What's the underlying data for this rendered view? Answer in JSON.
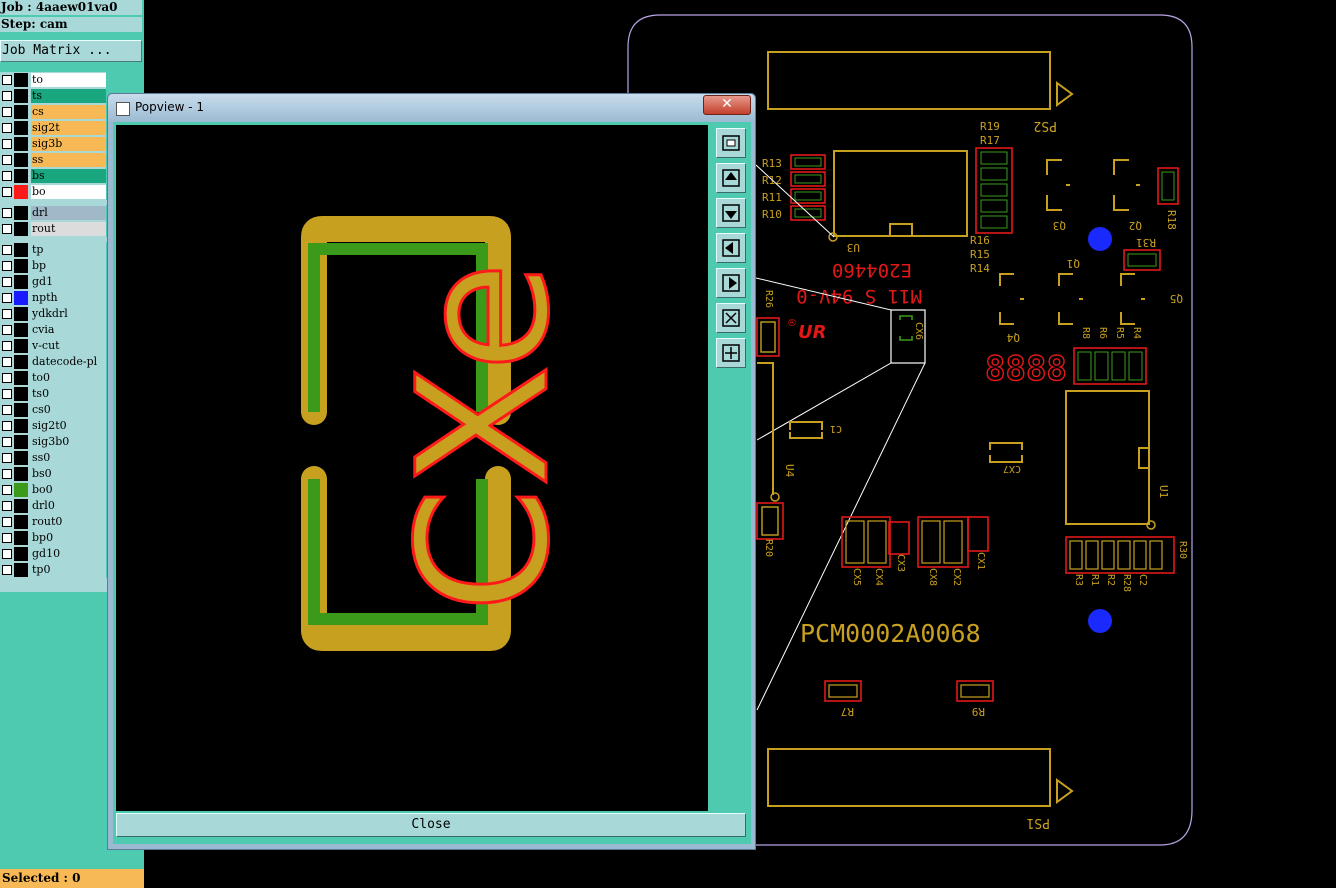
{
  "left_panel": {
    "job_line": "Job : 4aaew01va0",
    "step_line": "Step: cam",
    "job_matrix_label": "Job Matrix ...",
    "layers": [
      {
        "name": "to",
        "name_bg": "#ffffff",
        "swatch": ""
      },
      {
        "name": "ts",
        "name_bg": "#1aa67e",
        "swatch": ""
      },
      {
        "name": "cs",
        "name_bg": "#f7b955",
        "swatch": ""
      },
      {
        "name": "sig2t",
        "name_bg": "#f7b955",
        "swatch": ""
      },
      {
        "name": "sig3b",
        "name_bg": "#f7b955",
        "swatch": ""
      },
      {
        "name": "ss",
        "name_bg": "#f7b955",
        "swatch": ""
      },
      {
        "name": "bs",
        "name_bg": "#1aa67e",
        "swatch": ""
      },
      {
        "name": "bo",
        "name_bg": "#ffffff",
        "swatch": "#ff1a1a"
      },
      {
        "name": "drl",
        "name_bg": "#a0b8c8",
        "swatch": ""
      },
      {
        "name": "rout",
        "name_bg": "#dcdcdc",
        "swatch": ""
      },
      {
        "name": "tp",
        "name_bg": "#a8d8d8",
        "swatch": ""
      },
      {
        "name": "bp",
        "name_bg": "#a8d8d8",
        "swatch": ""
      },
      {
        "name": "gd1",
        "name_bg": "#a8d8d8",
        "swatch": ""
      },
      {
        "name": "npth",
        "name_bg": "#a8d8d8",
        "swatch": "#1a1aff"
      },
      {
        "name": "ydkdrl",
        "name_bg": "#a8d8d8",
        "swatch": ""
      },
      {
        "name": "cvia",
        "name_bg": "#a8d8d8",
        "swatch": ""
      },
      {
        "name": "v-cut",
        "name_bg": "#a8d8d8",
        "swatch": ""
      },
      {
        "name": "datecode-pl",
        "name_bg": "#a8d8d8",
        "swatch": ""
      },
      {
        "name": "to0",
        "name_bg": "#a8d8d8",
        "swatch": ""
      },
      {
        "name": "ts0",
        "name_bg": "#a8d8d8",
        "swatch": ""
      },
      {
        "name": "cs0",
        "name_bg": "#a8d8d8",
        "swatch": ""
      },
      {
        "name": "sig2t0",
        "name_bg": "#a8d8d8",
        "swatch": ""
      },
      {
        "name": "sig3b0",
        "name_bg": "#a8d8d8",
        "swatch": ""
      },
      {
        "name": "ss0",
        "name_bg": "#a8d8d8",
        "swatch": ""
      },
      {
        "name": "bs0",
        "name_bg": "#a8d8d8",
        "swatch": ""
      },
      {
        "name": "bo0",
        "name_bg": "#a8d8d8",
        "swatch": "#3c9a1a"
      },
      {
        "name": "drl0",
        "name_bg": "#a8d8d8",
        "swatch": ""
      },
      {
        "name": "rout0",
        "name_bg": "#a8d8d8",
        "swatch": ""
      },
      {
        "name": "bp0",
        "name_bg": "#a8d8d8",
        "swatch": ""
      },
      {
        "name": "gd10",
        "name_bg": "#a8d8d8",
        "swatch": ""
      },
      {
        "name": "tp0",
        "name_bg": "#a8d8d8",
        "swatch": ""
      }
    ],
    "selected_line": "Selected : 0"
  },
  "popview": {
    "title": "Popview - 1",
    "close_x": "✕",
    "close_button": "Close",
    "zoom_text": "CXe",
    "tool_icons": [
      "zoom-window-icon",
      "pan-up-icon",
      "pan-down-icon",
      "pan-left-icon",
      "pan-right-icon",
      "zoom-fit-icon",
      "zoom-home-icon"
    ]
  },
  "board": {
    "labels": {
      "ps2": "PS2",
      "ps1": "PS1",
      "r19": "R19",
      "r17": "R17",
      "r13": "R13",
      "r12": "R12",
      "r11": "R11",
      "r10": "R10",
      "r16": "R16",
      "r15": "R15",
      "r14": "R14",
      "u3": "U3",
      "q3": "Q3",
      "q2": "Q2",
      "r18": "R18",
      "r31": "R31",
      "q1": "Q1",
      "q4": "Q4",
      "q5": "Q5",
      "marking1": "E204460",
      "marking2": "M11 S 94V-0",
      "ur": "UR",
      "cx6": "CX6",
      "r26": "R26",
      "c1": "C1",
      "cx7": "CX7",
      "r8": "R8",
      "r6": "R6",
      "r5": "R5",
      "r4": "R4",
      "u4": "U4",
      "u1": "U1",
      "r20": "R20",
      "r28": "R28",
      "cx5": "CX5",
      "cx4": "CX4",
      "cx3": "CX3",
      "cx8": "CX8",
      "cx2": "CX2",
      "cx1": "CX1",
      "r3": "R3",
      "r1": "R1",
      "r2": "R2",
      "c2": "C2",
      "r30": "R30",
      "part_no": "PCM0002A0068",
      "r7": "R7",
      "r9": "R9",
      "datecode": "8888"
    }
  },
  "colors": {
    "silk": "#c8a020",
    "copper_red": "#e01818",
    "green": "#3c9a1a",
    "outline": "#b9a4e6",
    "npth": "#1a2aff"
  }
}
